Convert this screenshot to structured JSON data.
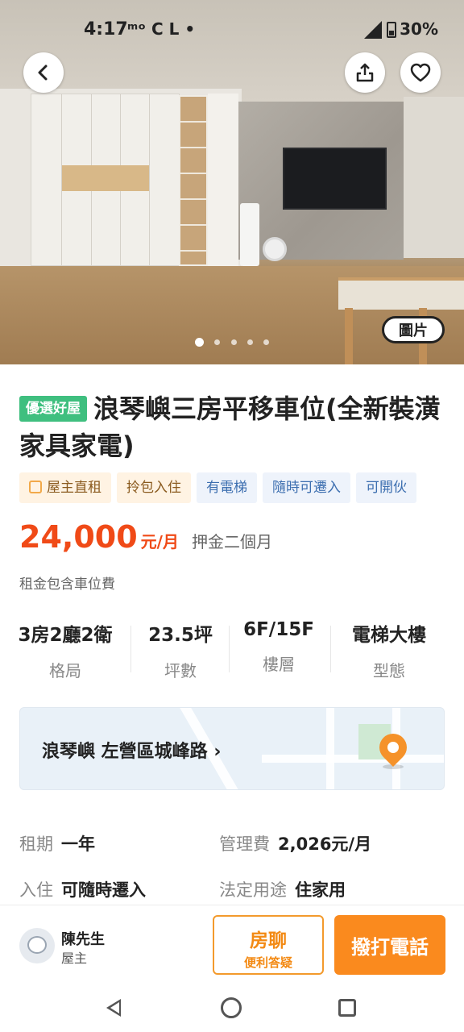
{
  "status_bar": {
    "time": "4:17",
    "left_icons": "ᵐᵒ C  L  •",
    "battery": "30%"
  },
  "hero": {
    "photo_button": "圖片",
    "slide_count": 5,
    "active_slide": 1
  },
  "listing": {
    "badge": "優選好屋",
    "title": "浪琴嶼三房平移車位(全新裝潢家具家電)",
    "tags": [
      {
        "label": "屋主直租",
        "style": "owner"
      },
      {
        "label": "拎包入住",
        "style": "bag"
      },
      {
        "label": "有電梯",
        "style": "blue"
      },
      {
        "label": "隨時可遷入",
        "style": "blue"
      },
      {
        "label": "可開伙",
        "style": "blue"
      }
    ],
    "price": "24,000",
    "price_unit": "元/月",
    "deposit": "押金二個月",
    "fee_note": "租金包含車位費"
  },
  "specs": [
    {
      "value": "3房2廳2衛",
      "label": "格局"
    },
    {
      "value": "23.5坪",
      "label": "坪數"
    },
    {
      "value": "6F/15F",
      "label": "樓層"
    },
    {
      "value": "電梯大樓",
      "label": "型態"
    }
  ],
  "location": {
    "text": "浪琴嶼 左營區城峰路 ›"
  },
  "details": [
    {
      "key": "租期",
      "value": "一年"
    },
    {
      "key": "管理費",
      "value": "2,026元/月"
    },
    {
      "key": "入住",
      "value": "可隨時遷入"
    },
    {
      "key": "法定用途",
      "value": "住家用"
    }
  ],
  "contact": {
    "name": "陳先生",
    "role": "屋主",
    "chat_label": "房聊",
    "chat_sub": "便利答疑",
    "call_label": "撥打電話"
  },
  "colors": {
    "accent_orange": "#fa8a1e",
    "price_red": "#f04a17",
    "premium_green": "#3fbf7f"
  }
}
